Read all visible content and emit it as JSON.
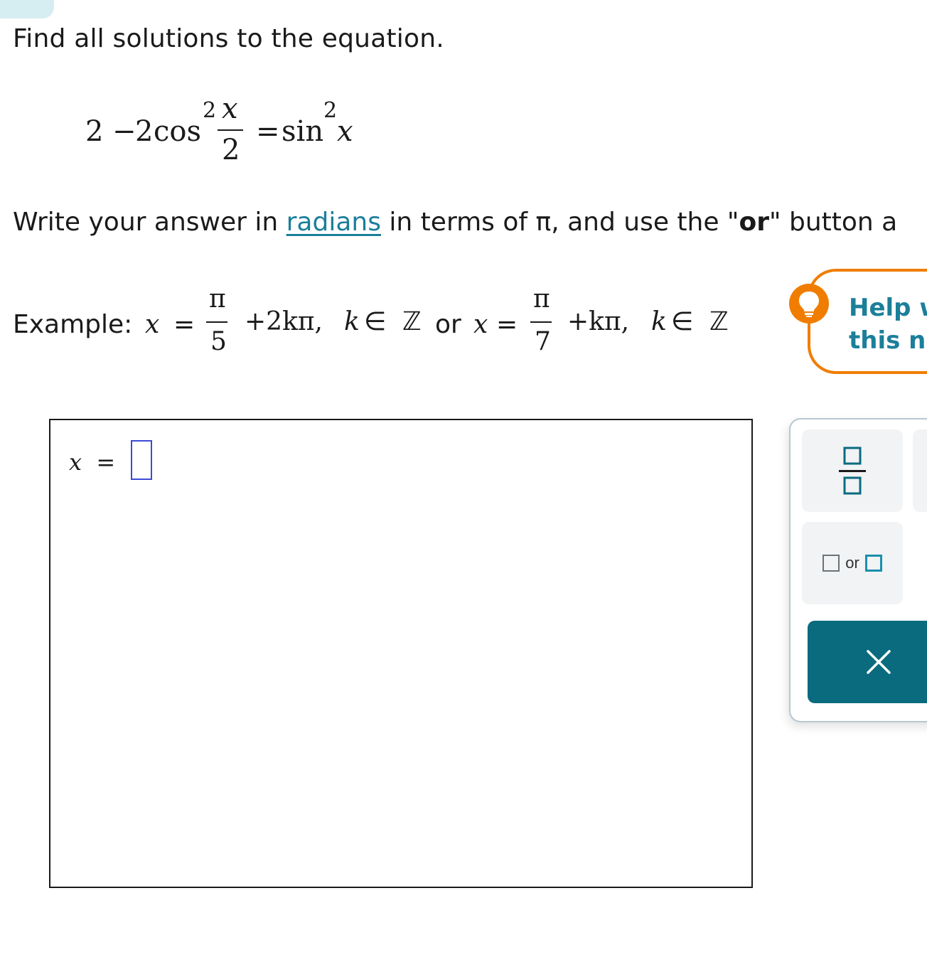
{
  "question": {
    "prompt": "Find all solutions to the equation.",
    "equation": {
      "lhs_constant": "2",
      "minus": "−",
      "coefficient": "2",
      "function_1": "cos",
      "power_1": "2",
      "numerator": "x",
      "denominator": "2",
      "equals": "=",
      "function_2": "sin",
      "power_2": "2",
      "variable": "x"
    },
    "instruction": {
      "before_link": "Write your answer in ",
      "link": "radians",
      "middle": " in terms of π, and use the \"",
      "bold": "or",
      "after": "\" button a"
    },
    "example": {
      "label": "Example:",
      "x1": "x",
      "eq1": "=",
      "num1": "π",
      "den1": "5",
      "term1": "+2kπ,",
      "k1": "k",
      "in1": "∈",
      "set1": "ℤ",
      "or": "or",
      "x2": "x",
      "eq2": "=",
      "num2": "π",
      "den2": "7",
      "term2": "+kπ,",
      "k2": "k",
      "in2": "∈",
      "set2": "ℤ"
    }
  },
  "help": {
    "line1": "Help w",
    "line2": "this nc",
    "icon": "lightbulb-icon",
    "accent": "#f07d00"
  },
  "answer": {
    "variable": "x",
    "equals": "=",
    "value": ""
  },
  "tools": {
    "fraction_icon": "fraction-template-icon",
    "or_label": "or",
    "clear_symbol": "×",
    "clear_color": "#0a6b7f"
  }
}
